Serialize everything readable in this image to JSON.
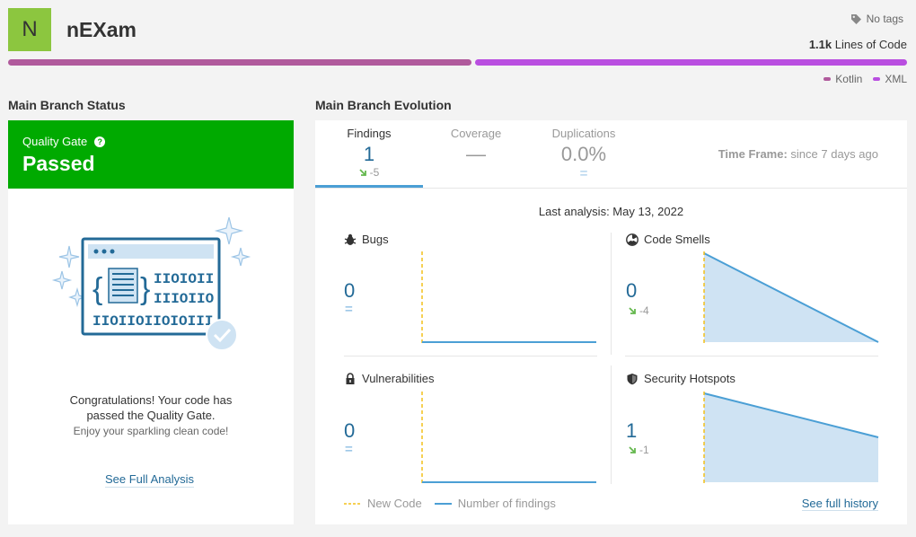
{
  "project": {
    "initial": "N",
    "name": "nEXam",
    "tags": "No tags",
    "loc_value": "1.1k",
    "loc_label": "Lines of Code",
    "colors": {
      "avatar": "#8cc63f",
      "kotlin": "#b05a9c",
      "xml": "#b94ee0"
    }
  },
  "languages": [
    {
      "name": "Kotlin",
      "color": "#b05a9c"
    },
    {
      "name": "XML",
      "color": "#b94ee0"
    }
  ],
  "status": {
    "title": "Main Branch Status",
    "qg_label": "Quality Gate",
    "qg_help": "?",
    "qg_status": "Passed",
    "qg_color": "#00aa00",
    "congrats": "Congratulations! Your code has passed the Quality Gate.",
    "enjoy": "Enjoy your sparkling clean code!",
    "full_analysis": "See Full Analysis"
  },
  "evolution": {
    "title": "Main Branch Evolution",
    "tabs": [
      {
        "label": "Findings",
        "value": "1",
        "delta": "-5"
      },
      {
        "label": "Coverage",
        "value": "—",
        "delta": ""
      },
      {
        "label": "Duplications",
        "value": "0.0%",
        "delta": "="
      }
    ],
    "timeframe_label": "Time Frame:",
    "timeframe_value": "since 7 days ago",
    "last_analysis": "Last analysis: May 13, 2022",
    "metrics": {
      "bugs": {
        "title": "Bugs",
        "value": "0",
        "delta": "=",
        "icon": "bug-icon"
      },
      "code_smells": {
        "title": "Code Smells",
        "value": "0",
        "delta": "-4",
        "icon": "radiation-icon"
      },
      "vulnerabilities": {
        "title": "Vulnerabilities",
        "value": "0",
        "delta": "=",
        "icon": "lock-icon"
      },
      "security_hotspots": {
        "title": "Security Hotspots",
        "value": "1",
        "delta": "-1",
        "icon": "shield-icon"
      }
    },
    "legend_new_code": "New Code",
    "legend_findings": "Number of findings",
    "full_history": "See full history"
  }
}
